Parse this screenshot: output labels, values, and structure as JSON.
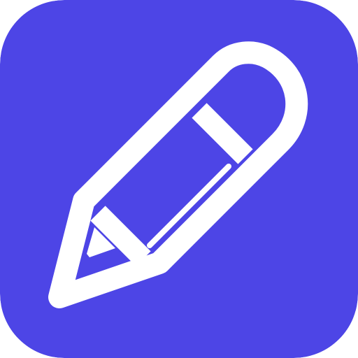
{
  "icon": {
    "name": "pencil-icon",
    "background_color": "#4D45E6",
    "foreground_color": "#FFFFFF"
  }
}
